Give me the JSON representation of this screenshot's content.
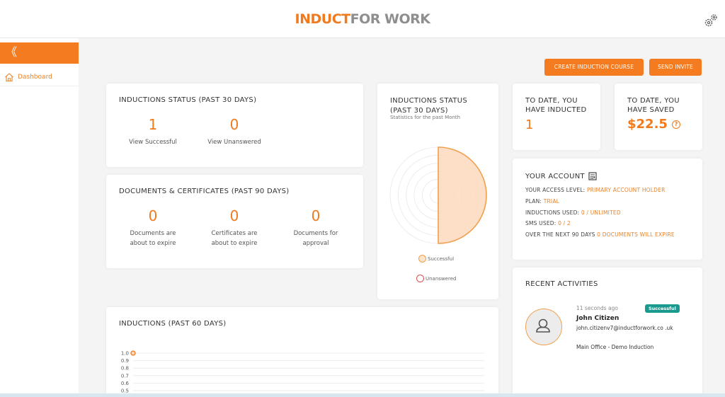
{
  "header": {
    "logo_part1": "INDUCT",
    "logo_part2": "FOR WORK",
    "settings_icon": "gear-icon"
  },
  "sidebar": {
    "collapse_label": "《",
    "items": [
      {
        "label": "Dashboard",
        "icon": "home-icon"
      }
    ]
  },
  "actions": {
    "create_label": "CREATE INDUCTION COURSE",
    "invite_label": "SEND INVITE"
  },
  "inductions_status": {
    "title": "INDUCTIONS STATUS (PAST 30 DAYS)",
    "successful_count": "1",
    "successful_label": "View Successful",
    "unanswered_count": "0",
    "unanswered_label": "View Unanswered"
  },
  "documents": {
    "title": "DOCUMENTS & CERTIFICATES (PAST 90 DAYS)",
    "items": [
      {
        "count": "0",
        "line1": "Documents are",
        "line2": "about to expire"
      },
      {
        "count": "0",
        "line1": "Certificates are",
        "line2": "about to expire"
      },
      {
        "count": "0",
        "line1": "Documents for",
        "line2": "approval"
      }
    ]
  },
  "pie_card": {
    "title_line1": "INDUCTIONS STATUS",
    "title_line2": "(PAST 30 DAYS)",
    "subtitle": "Statistics for the past Month",
    "legend": [
      {
        "label": "Successful",
        "color": "#f0a050"
      },
      {
        "label": "Unanswered",
        "color": "#d9534f"
      }
    ]
  },
  "inducted": {
    "title_line1": "TO DATE, YOU",
    "title_line2": "HAVE INDUCTED",
    "value": "1"
  },
  "saved": {
    "title_line1": "TO DATE, YOU",
    "title_line2": "HAVE SAVED",
    "value": "$22.5",
    "help_icon": "question-icon"
  },
  "account": {
    "title": "YOUR ACCOUNT",
    "icon": "calculator-icon",
    "access_label": "YOUR ACCESS LEVEL: ",
    "access_value": "PRIMARY ACCOUNT HOLDER",
    "plan_label": "PLAN: ",
    "plan_value": "TRIAL",
    "inductions_label": "INDUCTIONS USED: ",
    "inductions_value": "0 / UNLIMITED",
    "sms_label": "SMS USED: ",
    "sms_value": "0 / 2",
    "expire_label": "OVER THE NEXT 90 DAYS ",
    "expire_value": "0 DOCUMENTS WILL EXPIRE"
  },
  "recent": {
    "title": "RECENT ACTIVITIES",
    "activity": {
      "time": "11 seconds ago",
      "badge": "Successful",
      "name": "John Citizen",
      "email": "john.citizenv7@inductforwork.co .uk",
      "course": "Main Office - Demo Induction"
    }
  },
  "inductions60": {
    "title": "INDUCTIONS (PAST 60 DAYS)"
  },
  "colors": {
    "accent": "#f47b20",
    "badge": "#1a9a8f"
  },
  "chart_data": [
    {
      "type": "pie",
      "categories": [
        "Successful",
        "Unanswered"
      ],
      "values": [
        1,
        0
      ]
    },
    {
      "type": "line",
      "ylim": [
        0,
        1.0
      ],
      "y_ticks": [
        "1.0",
        "0.9",
        "0.8",
        "0.7",
        "0.6",
        "0.5"
      ],
      "series": [
        {
          "values": [
            1.0
          ]
        }
      ]
    }
  ]
}
